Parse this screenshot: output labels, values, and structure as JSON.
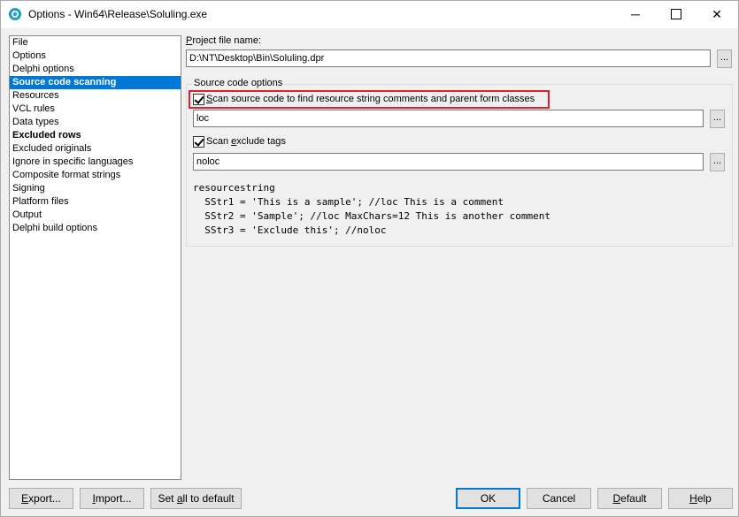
{
  "window": {
    "title": "Options - Win64\\Release\\Soluling.exe",
    "controls": {
      "minimize": "─",
      "close": "✕"
    }
  },
  "nav": {
    "items": [
      {
        "label": "File"
      },
      {
        "label": "Options"
      },
      {
        "label": "Delphi options"
      },
      {
        "label": "Source code scanning",
        "selected": true
      },
      {
        "label": "Resources"
      },
      {
        "label": "VCL rules"
      },
      {
        "label": "Data types"
      },
      {
        "label": "Excluded rows",
        "bold": true
      },
      {
        "label": "Excluded originals"
      },
      {
        "label": "Ignore in specific languages"
      },
      {
        "label": "Composite format strings"
      },
      {
        "label": "Signing"
      },
      {
        "label": "Platform files"
      },
      {
        "label": "Output"
      },
      {
        "label": "Delphi build options"
      }
    ]
  },
  "project": {
    "label_accel": "P",
    "label_rest": "roject file name:",
    "value": "D:\\NT\\Desktop\\Bin\\Soluling.dpr",
    "browse": "..."
  },
  "source_options": {
    "group_title": "Source code options",
    "scan_comments": {
      "checked": true,
      "label_accel": "S",
      "label_rest": "can source code to find resource string comments and parent form classes",
      "value": "loc",
      "browse": "..."
    },
    "scan_exclude": {
      "checked": true,
      "label_pre": "Scan ",
      "label_accel": "e",
      "label_rest": "xclude tags",
      "value": "noloc",
      "browse": "..."
    },
    "code_sample": [
      "resourcestring",
      "  SStr1 = 'This is a sample'; //loc This is a comment",
      "  SStr2 = 'Sample'; //loc MaxChars=12 This is another comment",
      "  SStr3 = 'Exclude this'; //noloc"
    ]
  },
  "buttons": {
    "export": {
      "accel": "E",
      "rest": "xport..."
    },
    "import": {
      "accel": "I",
      "rest": "mport..."
    },
    "set_all_default": {
      "pre": "Set ",
      "accel": "a",
      "rest": "ll to default"
    },
    "ok": "OK",
    "cancel": "Cancel",
    "default": {
      "accel": "D",
      "rest": "efault"
    },
    "help": {
      "accel": "H",
      "rest": "elp"
    }
  },
  "colors": {
    "selection": "#0078d7",
    "highlight_border": "#e0202a",
    "app_icon": "#1aa0c8"
  }
}
